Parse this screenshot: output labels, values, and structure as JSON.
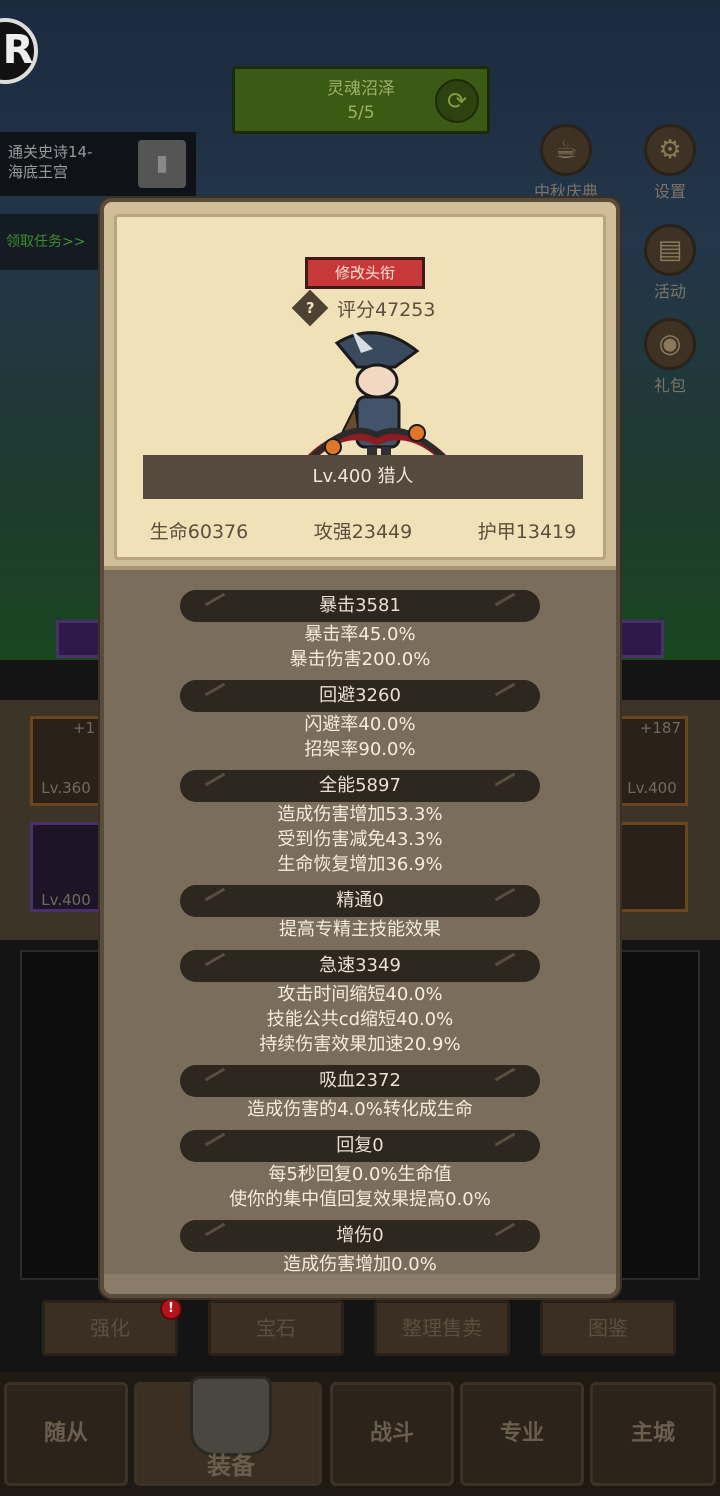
{
  "hud": {
    "logo_letter": "R",
    "stage_name": "灵魂沼泽",
    "stage_progress": "5/5",
    "quest_text_line1": "通关史诗14-",
    "quest_text_line2": "海底王宫",
    "quest_claim": "领取任务>>"
  },
  "side_buttons": [
    {
      "label": "中秋庆典",
      "icon": "mooncake-festival-icon"
    },
    {
      "label": "设置",
      "icon": "gear-icon"
    },
    {
      "label": "活动",
      "icon": "scroll-icon"
    },
    {
      "label": "礼包",
      "icon": "giftbag-icon"
    }
  ],
  "equipment_partial": {
    "left_top_plus": "+1",
    "left_top_level": "Lv.360",
    "left_bottom_level": "Lv.400",
    "right_top_plus": "+187",
    "right_top_level": "Lv.400"
  },
  "sub_tabs": [
    "强化",
    "宝石",
    "整理售卖",
    "图鉴"
  ],
  "sub_tab_badge": "!",
  "nav": {
    "items": [
      "随从",
      "装备",
      "战斗",
      "专业",
      "主城"
    ],
    "active": "装备"
  },
  "profile": {
    "edit_title_button": "修改头衔",
    "score": "评分47253",
    "help_symbol": "?",
    "name_level": "Lv.400 猎人",
    "stats": [
      "生命60376",
      "攻强23449",
      "护甲13419"
    ]
  },
  "sections": [
    {
      "header": "暴击3581",
      "lines": [
        "暴击率45.0%",
        "暴击伤害200.0%"
      ]
    },
    {
      "header": "回避3260",
      "lines": [
        "闪避率40.0%",
        "招架率90.0%"
      ]
    },
    {
      "header": "全能5897",
      "lines": [
        "造成伤害增加53.3%",
        "受到伤害减免43.3%",
        "生命恢复增加36.9%"
      ]
    },
    {
      "header": "精通0",
      "lines": [
        "提高专精主技能效果"
      ]
    },
    {
      "header": "急速3349",
      "lines": [
        "攻击时间缩短40.0%",
        "技能公共cd缩短40.0%",
        "持续伤害效果加速20.9%"
      ]
    },
    {
      "header": "吸血2372",
      "lines": [
        "造成伤害的4.0%转化成生命"
      ]
    },
    {
      "header": "回复0",
      "lines": [
        "每5秒回复0.0%生命值",
        "使你的集中值回复效果提高0.0%"
      ]
    },
    {
      "header": "增伤0",
      "lines": [
        "造成伤害增加0.0%"
      ]
    }
  ]
}
